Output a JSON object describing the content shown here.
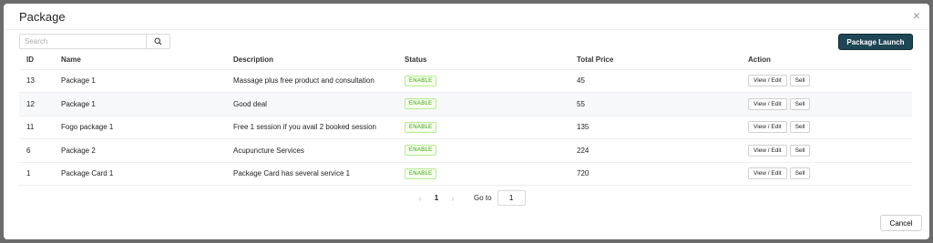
{
  "modal": {
    "title": "Package",
    "close_glyph": "×"
  },
  "search": {
    "placeholder": "Search"
  },
  "launch_label": "Package Launch",
  "table": {
    "headers": [
      "ID",
      "Name",
      "Description",
      "Status",
      "Total Price",
      "Action"
    ],
    "rows": [
      {
        "id": "13",
        "name": "Package 1",
        "description": "Massage plus free product and consultation",
        "status": "ENABLE",
        "price": "45"
      },
      {
        "id": "12",
        "name": "Package 1",
        "description": "Good deal",
        "status": "ENABLE",
        "price": "55"
      },
      {
        "id": "11",
        "name": "Fogo package 1",
        "description": "Free 1 session if you avail 2 booked session",
        "status": "ENABLE",
        "price": "135"
      },
      {
        "id": "6",
        "name": "Package 2",
        "description": "Acupuncture Services",
        "status": "ENABLE",
        "price": "224"
      },
      {
        "id": "1",
        "name": "Package Card 1",
        "description": "Package Card has several service 1",
        "status": "ENABLE",
        "price": "720"
      }
    ],
    "action_view": "View / Edit",
    "action_sell": "Sell"
  },
  "pagination": {
    "prev": "‹",
    "current": "1",
    "next": "›",
    "goto_label": "Go to",
    "goto_value": "1"
  },
  "cancel_label": "Cancel",
  "colors": {
    "primary": "#1f4654",
    "status_green": "#389e0d"
  },
  "icons": {
    "search": "search-icon",
    "close": "close-icon"
  }
}
